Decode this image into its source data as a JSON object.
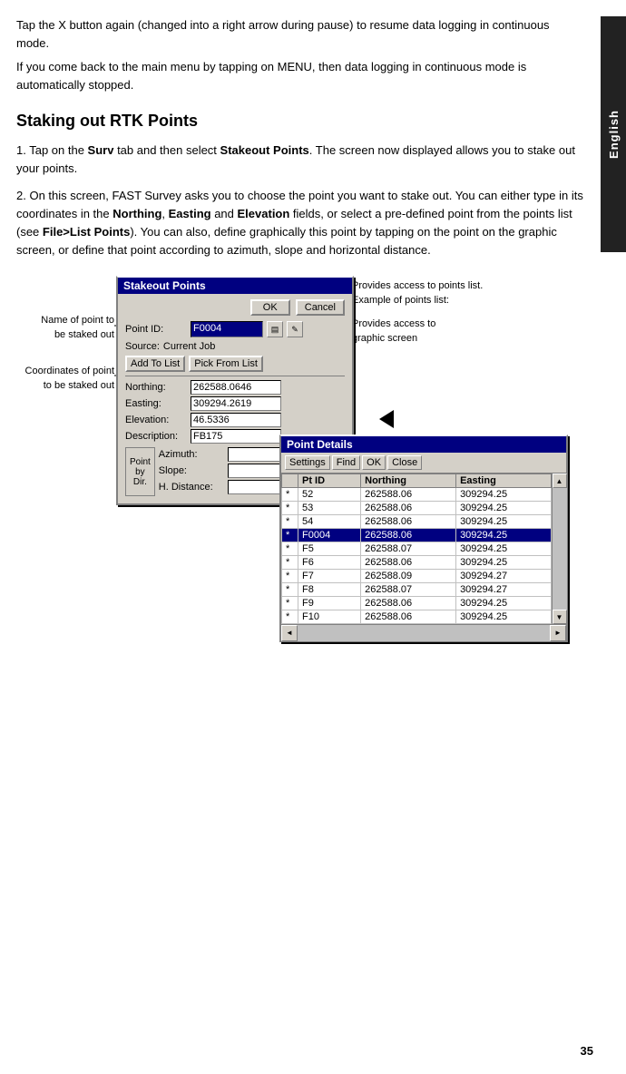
{
  "lang_label": "English",
  "page_number": "35",
  "intro": {
    "para1": "Tap the X button again (changed into a right arrow during pause) to resume data logging in continuous mode.",
    "para2": "If you come back to the main menu by tapping on MENU, then data logging in continuous mode is automatically stopped."
  },
  "section_title": "Staking out RTK Points",
  "steps": {
    "step1": "Tap on the Surv tab and then select Stakeout Points. The screen now displayed allows you to stake out your points.",
    "step2_pre": "On this screen, FAST Survey asks you to choose the point you want to stake out. You can either type in its coordinates in the ",
    "step2_bold1": "Northing",
    "step2_mid1": ", ",
    "step2_bold2": "Easting",
    "step2_mid2": " and ",
    "step2_bold3": "Elevation",
    "step2_mid3": " fields, or select a pre-defined point from the points list (see ",
    "step2_bold4": "File>List Points",
    "step2_mid4": "). You can also, define graphically this point by tapping on the point on the graphic screen, or define that point according to azimuth, slope and horizontal distance."
  },
  "stakeout_dialog": {
    "title": "Stakeout Points",
    "ok_btn": "OK",
    "cancel_btn": "Cancel",
    "point_id_label": "Point ID:",
    "point_id_value": "F0004",
    "source_label": "Source:",
    "source_value": "Current Job",
    "add_to_list_btn": "Add To List",
    "pick_from_list_btn": "Pick From List",
    "northing_label": "Northing:",
    "northing_value": "262588.0646",
    "easting_label": "Easting:",
    "easting_value": "309294.2619",
    "elevation_label": "Elevation:",
    "elevation_value": "46.5336",
    "description_label": "Description:",
    "description_value": "FB175",
    "point_by_dir": {
      "label": "Point by Dir.",
      "azimuth_label": "Azimuth:",
      "slope_label": "Slope:",
      "h_distance_label": "H. Distance:"
    }
  },
  "point_details_dialog": {
    "title": "Point Details",
    "settings_btn": "Settings",
    "find_btn": "Find",
    "ok_btn": "OK",
    "close_btn": "Close",
    "columns": [
      "Pt ID",
      "Northing",
      "Easting"
    ],
    "rows": [
      {
        "star": "*",
        "pt_id": "52",
        "northing": "262588.06",
        "easting": "309294.25",
        "selected": false
      },
      {
        "star": "*",
        "pt_id": "53",
        "northing": "262588.06",
        "easting": "309294.25",
        "selected": false
      },
      {
        "star": "*",
        "pt_id": "54",
        "northing": "262588.06",
        "easting": "309294.25",
        "selected": false
      },
      {
        "star": "*",
        "pt_id": "F0004",
        "northing": "262588.06",
        "easting": "309294.25",
        "selected": true
      },
      {
        "star": "*",
        "pt_id": "F5",
        "northing": "262588.07",
        "easting": "309294.25",
        "selected": false
      },
      {
        "star": "*",
        "pt_id": "F6",
        "northing": "262588.06",
        "easting": "309294.25",
        "selected": false
      },
      {
        "star": "*",
        "pt_id": "F7",
        "northing": "262588.09",
        "easting": "309294.27",
        "selected": false
      },
      {
        "star": "*",
        "pt_id": "F8",
        "northing": "262588.07",
        "easting": "309294.27",
        "selected": false
      },
      {
        "star": "*",
        "pt_id": "F9",
        "northing": "262588.06",
        "easting": "309294.25",
        "selected": false
      },
      {
        "star": "*",
        "pt_id": "F10",
        "northing": "262588.06",
        "easting": "309294.25",
        "selected": false
      }
    ]
  },
  "annotations": {
    "provides_access_points": "Provides access to points list.",
    "example_points_list": "Example of points list:",
    "provides_access_graphic": "Provides access to\ngraphic screen",
    "name_of_point": "Name of point to\nbe staked out",
    "coordinates_of_point": "Coordinates of point\nto be staked out"
  }
}
